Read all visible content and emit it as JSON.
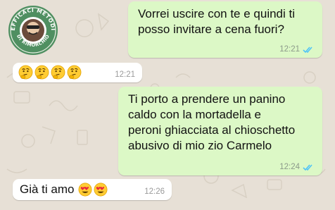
{
  "badge": {
    "top_text": "EFFICACI METODI",
    "bottom_text": "DI RIMORCHIO"
  },
  "messages": [
    {
      "id": "m1",
      "direction": "outgoing",
      "text": "Vorrei uscire con te e quindi ti\nposso invitare a cena fuori?",
      "time": "12:21",
      "status": "read"
    },
    {
      "id": "m2",
      "direction": "incoming",
      "emoji": [
        "thinking-face",
        "thinking-face",
        "thinking-face",
        "thinking-face"
      ],
      "time": "12:21"
    },
    {
      "id": "m3",
      "direction": "outgoing",
      "text": "Ti porto a prendere un panino\ncaldo con la mortadella e\nperoni ghiacciata al chioschetto\nabusivo di mio zio Carmelo",
      "time": "12:24",
      "status": "read"
    },
    {
      "id": "m4",
      "direction": "incoming",
      "text": "Già ti amo",
      "emoji": [
        "heart-eyes-face",
        "heart-eyes-face"
      ],
      "time": "12:26"
    }
  ],
  "colors": {
    "background": "#e7e0d6",
    "outgoing_bubble": "#dcf8c6",
    "incoming_bubble": "#ffffff",
    "read_ticks": "#4fc3f7"
  }
}
